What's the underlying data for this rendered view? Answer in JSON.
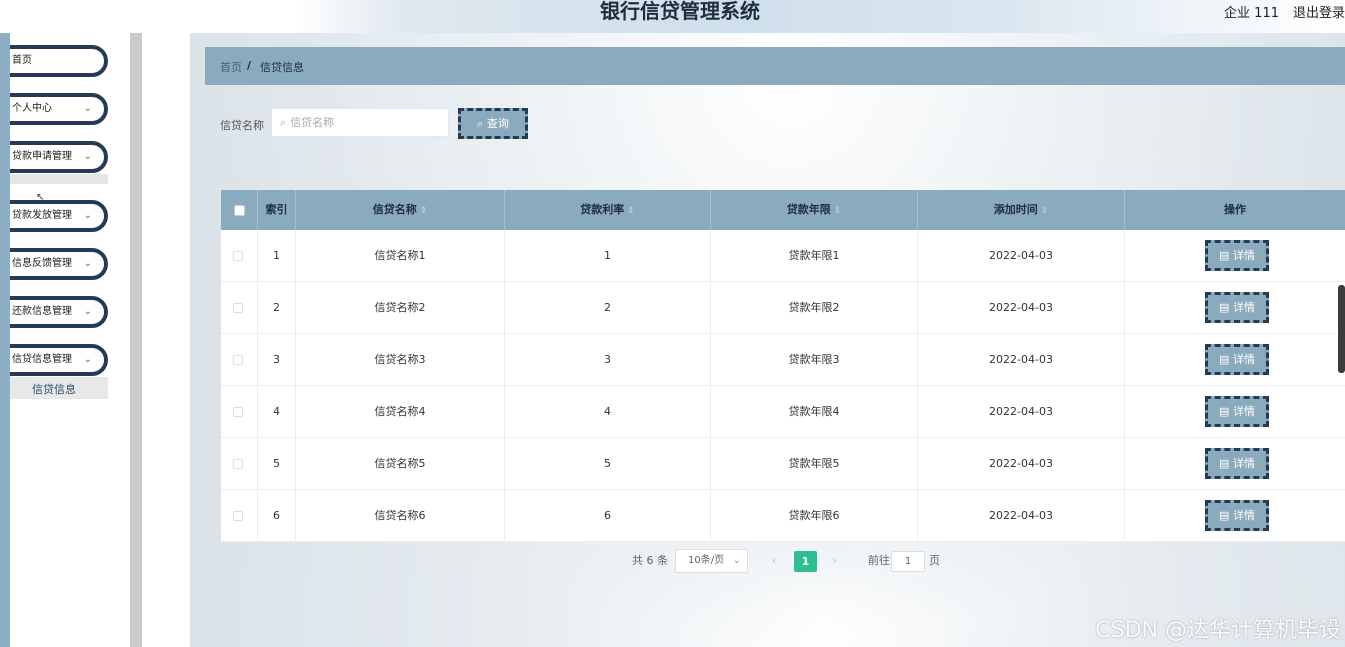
{
  "header": {
    "title": "银行信贷管理系统",
    "user": "企业 111",
    "logout": "退出登录"
  },
  "sidebar": {
    "items": [
      {
        "label": "首页",
        "chevron": ""
      },
      {
        "label": "个人中心",
        "chevron": "⌄"
      },
      {
        "label": "贷款申请管理",
        "chevron": "⌄"
      },
      {
        "label": "贷款发放管理",
        "chevron": "⌄"
      },
      {
        "label": "信息反馈管理",
        "chevron": "⌄"
      },
      {
        "label": "还款信息管理",
        "chevron": "⌄"
      },
      {
        "label": "信贷信息管理",
        "chevron": "⌄"
      }
    ],
    "active_sub": "信贷信息"
  },
  "breadcrumb": {
    "home": "首页",
    "sep": "/",
    "current": "信贷信息"
  },
  "search": {
    "label": "信贷名称",
    "placeholder": "信贷名称",
    "button": "查询"
  },
  "table": {
    "columns": [
      "索引",
      "信贷名称",
      "贷款利率",
      "贷款年限",
      "添加时间",
      "操作"
    ],
    "rows": [
      {
        "index": "1",
        "name": "信贷名称1",
        "rate": "1",
        "term": "贷款年限1",
        "date": "2022-04-03",
        "action": "详情"
      },
      {
        "index": "2",
        "name": "信贷名称2",
        "rate": "2",
        "term": "贷款年限2",
        "date": "2022-04-03",
        "action": "详情"
      },
      {
        "index": "3",
        "name": "信贷名称3",
        "rate": "3",
        "term": "贷款年限3",
        "date": "2022-04-03",
        "action": "详情"
      },
      {
        "index": "4",
        "name": "信贷名称4",
        "rate": "4",
        "term": "贷款年限4",
        "date": "2022-04-03",
        "action": "详情"
      },
      {
        "index": "5",
        "name": "信贷名称5",
        "rate": "5",
        "term": "贷款年限5",
        "date": "2022-04-03",
        "action": "详情"
      },
      {
        "index": "6",
        "name": "信贷名称6",
        "rate": "6",
        "term": "贷款年限6",
        "date": "2022-04-03",
        "action": "详情"
      }
    ]
  },
  "pagination": {
    "total": "共 6 条",
    "page_size": "10条/页",
    "current": "1",
    "goto_label": "前往",
    "goto_value": "1",
    "unit": "页"
  },
  "watermark": "CSDN @达华计算机毕设",
  "colors": {
    "accent": "#8aabbe",
    "dark_border": "#243b53",
    "pager_active": "#2ebf91"
  }
}
